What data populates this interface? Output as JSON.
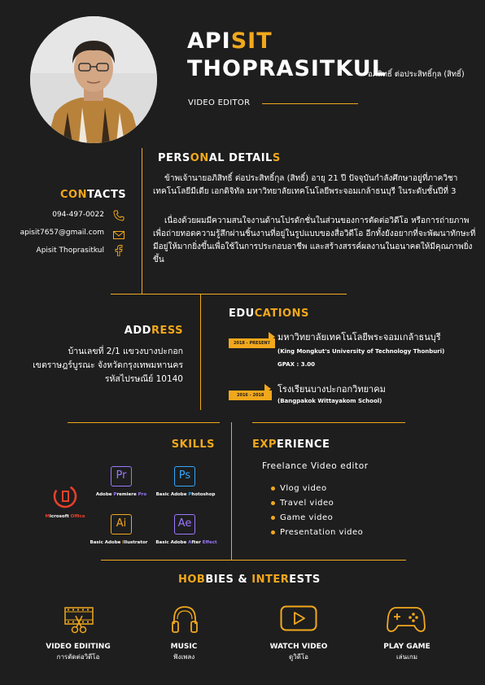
{
  "header": {
    "first_name_a": "API",
    "first_name_b": "SIT",
    "last_name": "THOPRASITKUL",
    "thai_name": "อภิสิทธิ์ ต่อประสิทธิ์กุล (สิทธิ์)",
    "job_title": "VIDEO EDITOR"
  },
  "personal": {
    "title_a": "PERS",
    "title_b": "ON",
    "title_c": "AL",
    "title_d": " DETAIL",
    "title_e": "S",
    "para1": "ข้าพเจ้านายอภิสิทธิ์ ต่อประสิทธิ์กุล (สิทธิ์) อายุ 21 ปี ปัจจุบันกำลังศึกษาอยู่ที่ภาควิชาเทคโนโลยีมีเดีย เอกดิจิทัล มหาวิทยาลัยเทคโนโลยีพระจอมเกล้าธนบุรี ในระดับชั้นปีที่ 3",
    "para2": "เนื่องด้วยผมมีความสนใจงานด้านโปรดักชั่นในส่วนของการตัดต่อวิดีโอ หรือการถ่ายภาพเพื่อถ่ายทอดความรู้สึกผ่านชิ้นงานที่อยู่ในรูปแบบของสื่อวิดีโอ อีกทั้งยังอยากที่จะพัฒนาทักษะที่มีอยู่ให้มากยิ่งขึ้นเพื่อใช้ในการประกอบอาชีพ และสร้างสรรค์ผลงานในอนาคตให้มีคุณภาพยิ่งขึ้น"
  },
  "contacts": {
    "title_a": "CON",
    "title_b": "TACTS",
    "phone": "094-497-0022",
    "email": "apisit7657@gmail.com",
    "facebook": "Apisit Thoprasitkul"
  },
  "address": {
    "title_a": "ADD",
    "title_b": "RESS",
    "line1": "บ้านเลขที่ 2/1 แขวงบางปะกอก",
    "line2": "เขตราษฎร์บูรณะ จังหวัดกรุงเทพมหานคร",
    "line3": "รหัสไปรษณีย์ 10140"
  },
  "education": {
    "title_a": "EDU",
    "title_b": "CATIONS",
    "items": [
      {
        "badge": "2018 - PRESENT",
        "name_th": "มหาวิทยาลัยเทคโนโลยีพระจอมเกล้าธนบุรี",
        "name_en": "(King Mongkut's University of Technology Thonburi)",
        "gpa": "GPAX : 3.00"
      },
      {
        "badge": "2016 - 2018",
        "name_th": "โรงเรียนบางปะกอกวิทยาคม",
        "name_en": "(Bangpakok Wittayakom School)"
      }
    ]
  },
  "skills": {
    "title_a": "SKI",
    "title_b": "LLS",
    "items": [
      {
        "icon_text": "Pr",
        "label_a": "Adobe ",
        "label_b": "P",
        "label_c": "remiere ",
        "label_d": "Pro",
        "color": "#9b78ff"
      },
      {
        "icon_text": "Ps",
        "label_a": "Basic Adobe ",
        "label_b": "P",
        "label_c": "hotoshop",
        "label_d": "",
        "color": "#31a8ff"
      },
      {
        "icon_text": "",
        "label_a": "",
        "label_b": "M",
        "label_c": "icrosoft ",
        "label_d": "Office",
        "color": "#e8412c"
      },
      {
        "icon_text": "Ai",
        "label_a": "Basic Adobe ",
        "label_b": "I",
        "label_c": "llustrator",
        "label_d": "",
        "color": "#f2a81d"
      },
      {
        "icon_text": "Ae",
        "label_a": "Basic Adobe ",
        "label_b": "A",
        "label_c": "fter ",
        "label_d": "Effect",
        "color": "#9b78ff"
      }
    ]
  },
  "experience": {
    "title_a": "EXP",
    "title_b": "ERIENCE",
    "role": "Freelance Video editor",
    "items": [
      "Vlog video",
      "Travel video",
      "Game video",
      "Presentation video"
    ]
  },
  "hobbies": {
    "title_a": "HOB",
    "title_b": "BIES",
    "title_c": " & ",
    "title_d": "INTER",
    "title_e": "ESTS",
    "items": [
      {
        "label": "VIDEO EDIITING",
        "sub": "การตัดต่อวิดีโอ",
        "icon": "film-edit-icon"
      },
      {
        "label": "MUSIC",
        "sub": "ฟังเพลง",
        "icon": "headphones-icon"
      },
      {
        "label": "WATCH VIDEO",
        "sub": "ดูวิดีโอ",
        "icon": "play-video-icon"
      },
      {
        "label": "PLAY GAME",
        "sub": "เล่นเกม",
        "icon": "gamepad-icon"
      }
    ]
  },
  "colors": {
    "accent": "#f2a81d",
    "background": "#1e1e1e",
    "text": "#ffffff"
  }
}
